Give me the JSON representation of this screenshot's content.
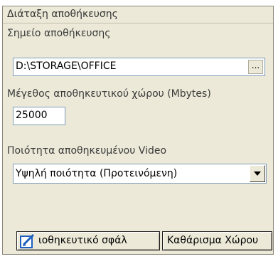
{
  "panel": {
    "title": "Διάταξη αποθήκευσης"
  },
  "storage_location": {
    "label": "Σημείο αποθήκευσης",
    "value": "D:\\STORAGE\\OFFICE",
    "browse_label": "..."
  },
  "storage_size": {
    "label": "Μέγεθος αποθηκευτικού χώρου (Mbytes)",
    "value": "25000"
  },
  "video_quality": {
    "label": "Ποιότητα αποθηκευμένου Video",
    "selected": "Υψηλή ποιότητα  (Προτεινόμενη)"
  },
  "buttons": {
    "error_label": "ιοθηκευτικό σφάλ",
    "clear_label": "Καθάρισμα Χώρου"
  },
  "icons": {
    "error_button_icon": "edit-document-icon",
    "combo_arrow": "chevron-down-icon"
  },
  "colors": {
    "panel_bg": "#ece9d8",
    "field_border": "#7f9db9",
    "icon_blue": "#1f5fbf"
  }
}
